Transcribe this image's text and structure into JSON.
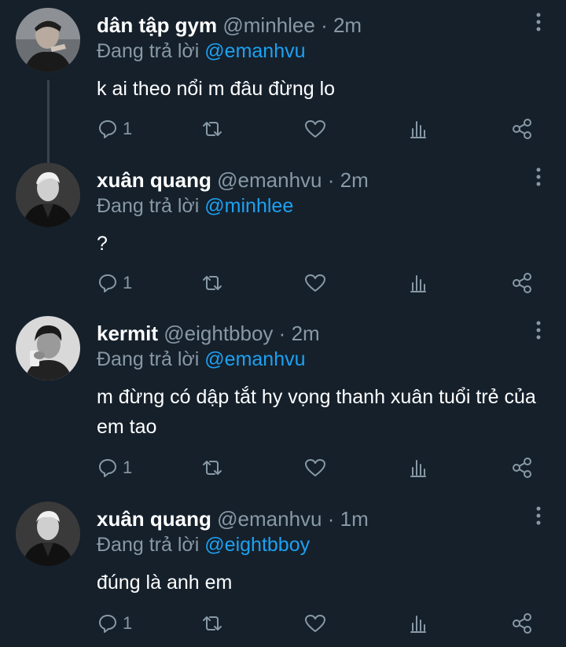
{
  "tweets": [
    {
      "name": "dân tập gym",
      "handle": "@minhlee",
      "time": "2m",
      "reply_prefix": "Đang trả lời",
      "reply_to": "@emanhvu",
      "text": "k ai theo nổi m đâu đừng lo",
      "reply_count": "1"
    },
    {
      "name": "xuân quang",
      "handle": "@emanhvu",
      "time": "2m",
      "reply_prefix": "Đang trả lời",
      "reply_to": "@minhlee",
      "text": "?",
      "reply_count": "1"
    },
    {
      "name": "kermit",
      "handle": "@eightbboy",
      "time": "2m",
      "reply_prefix": "Đang trả lời",
      "reply_to": "@emanhvu",
      "text": "m đừng có dập tắt hy vọng thanh xuân tuổi trẻ của em tao",
      "reply_count": "1"
    },
    {
      "name": "xuân quang",
      "handle": "@emanhvu",
      "time": "1m",
      "reply_prefix": "Đang trả lời",
      "reply_to": "@eightbboy",
      "text": "đúng là anh em",
      "reply_count": "1"
    }
  ],
  "icons": [
    "reply-icon",
    "retweet-icon",
    "like-icon",
    "analytics-icon",
    "share-icon",
    "more-icon"
  ],
  "colors": {
    "background": "#15202b",
    "muted": "#8899a6",
    "accent": "#1da1f2",
    "text": "#ffffff"
  }
}
